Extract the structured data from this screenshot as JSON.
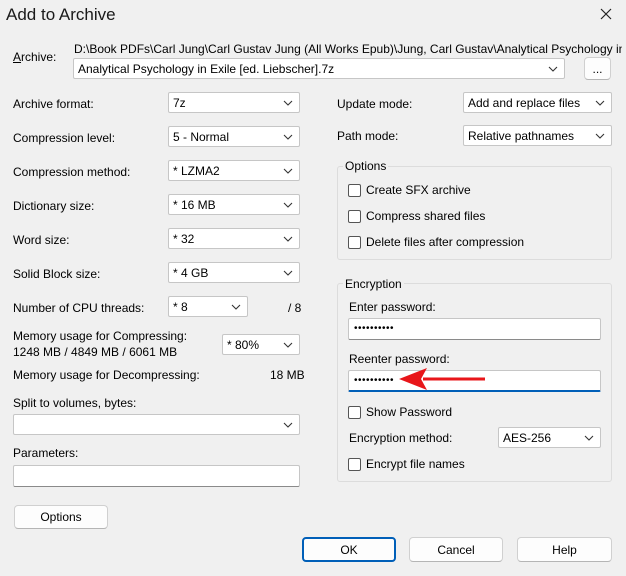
{
  "window": {
    "title": "Add to Archive",
    "close_icon": "×"
  },
  "archive": {
    "label": "Archive:",
    "path": "D:\\Book PDFs\\Carl Jung\\Carl Gustav Jung (All Works Epub)\\Jung, Carl Gustav\\Analytical Psychology in Exile [ed.",
    "filename": "Analytical Psychology in Exile [ed. Liebscher].7z",
    "browse_label": "..."
  },
  "left": {
    "archive_format": {
      "label": "Archive format:",
      "value": "7z"
    },
    "compression_level": {
      "label": "Compression level:",
      "value": "5 - Normal"
    },
    "compression_method": {
      "label": "Compression method:",
      "value": "*  LZMA2"
    },
    "dictionary_size": {
      "label": "Dictionary size:",
      "value": "*  16 MB"
    },
    "word_size": {
      "label": "Word size:",
      "value": "*  32"
    },
    "solid_block_size": {
      "label": "Solid Block size:",
      "value": "*  4 GB"
    },
    "cpu_threads": {
      "label": "Number of CPU threads:",
      "value": "*  8",
      "max": "/ 8"
    },
    "memory_compress": {
      "label": "Memory usage for Compressing:",
      "detail": "1248 MB / 4849 MB / 6061 MB",
      "value": "* 80%"
    },
    "memory_decompress": {
      "label": "Memory usage for Decompressing:",
      "value": "18 MB"
    },
    "split_volumes": {
      "label": "Split to volumes, bytes:",
      "value": ""
    },
    "parameters": {
      "label": "Parameters:",
      "value": ""
    },
    "options_button": "Options"
  },
  "right": {
    "update_mode": {
      "label": "Update mode:",
      "value": "Add and replace files"
    },
    "path_mode": {
      "label": "Path mode:",
      "value": "Relative pathnames"
    },
    "options_group": {
      "label": "Options",
      "items": [
        {
          "label": "Create SFX archive",
          "checked": false
        },
        {
          "label": "Compress shared files",
          "checked": false
        },
        {
          "label": "Delete files after compression",
          "checked": false
        }
      ]
    },
    "encryption": {
      "label": "Encryption",
      "enter_password_label": "Enter password:",
      "enter_password_value": "••••••••••",
      "reenter_password_label": "Reenter password:",
      "reenter_password_value": "••••••••••",
      "show_password_label": "Show Password",
      "method_label": "Encryption method:",
      "method_value": "AES-256",
      "encrypt_names_label": "Encrypt file names"
    }
  },
  "buttons": {
    "ok": "OK",
    "cancel": "Cancel",
    "help": "Help"
  },
  "annotation": {
    "arrow_color": "#e8161a"
  }
}
